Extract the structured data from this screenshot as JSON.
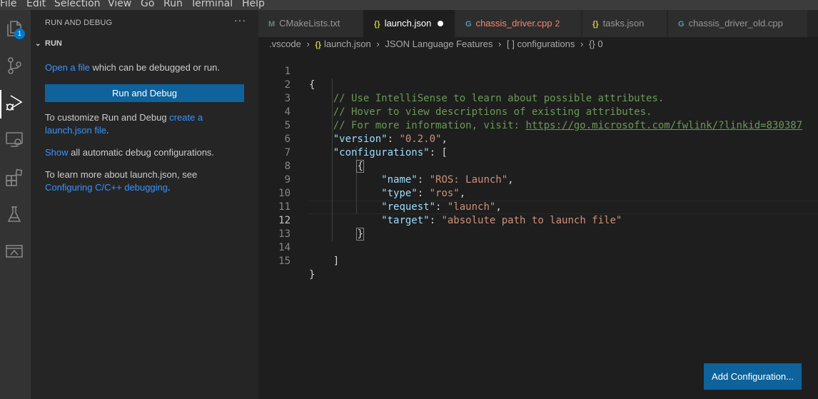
{
  "menu": {
    "file": "File",
    "edit": "Edit",
    "selection": "Selection",
    "view": "View",
    "go": "Go",
    "run": "Run",
    "terminal": "Terminal",
    "help": "Help"
  },
  "activity": {
    "explorer_badge": "1",
    "icons": [
      "files-icon",
      "source-control-icon",
      "run-debug-icon",
      "remote-explorer-icon",
      "extensions-icon",
      "testing-icon",
      "ports-icon"
    ]
  },
  "sidebar": {
    "title": "RUN AND DEBUG",
    "more": "···",
    "section": "RUN",
    "open_file_link": "Open a file",
    "open_file_rest": " which can be debugged or run.",
    "run_button": "Run and Debug",
    "customize_text": "To customize Run and Debug ",
    "customize_link": "create a launch.json file",
    "customize_end": ".",
    "show_link": "Show",
    "show_rest": " all automatic debug configurations.",
    "learn_text": "To learn more about launch.json, see ",
    "learn_link": "Configuring C/C++ debugging",
    "learn_end": "."
  },
  "tabs": [
    {
      "icon": "M",
      "label": "CMakeLists.txt"
    },
    {
      "icon": "{}",
      "label": "launch.json"
    },
    {
      "icon": "G",
      "label": "chassis_driver.cpp",
      "count": "2"
    },
    {
      "icon": "{}",
      "label": "tasks.json"
    },
    {
      "icon": "G",
      "label": "chassis_driver_old.cpp"
    }
  ],
  "breadcrumb": {
    "folder": ".vscode",
    "file_icon": "{}",
    "file": "launch.json",
    "features": "JSON Language Features",
    "array_icon": "[ ]",
    "configurations": "configurations",
    "obj_icon": "{}",
    "index": "0"
  },
  "editor": {
    "line_numbers": [
      "1",
      "2",
      "3",
      "4",
      "5",
      "6",
      "7",
      "8",
      "9",
      "10",
      "11",
      "12",
      "13",
      "14",
      "15"
    ],
    "current_line": "12",
    "lines": {
      "l1": "{",
      "l2": "    // Use IntelliSense to learn about possible attributes.",
      "l3": "    // Hover to view descriptions of existing attributes.",
      "l4_pre": "    // For more information, visit: ",
      "l4_url": "https://go.microsoft.com/fwlink/?linkid=830387",
      "l5_key": "\"version\"",
      "l5_val": "\"0.2.0\"",
      "l6_key": "\"configurations\"",
      "l6_rest": ": [",
      "l7": "{",
      "l8_key": "\"name\"",
      "l8_val": "\"ROS: Launch\"",
      "l9_key": "\"type\"",
      "l9_val": "\"ros\"",
      "l10_key": "\"request\"",
      "l10_val": "\"launch\"",
      "l11_key": "\"target\"",
      "l11_val": "\"absolute path to launch file\"",
      "l12": "}",
      "l14": "]",
      "l15": "}"
    }
  },
  "add_configuration_button": "Add Configuration..."
}
